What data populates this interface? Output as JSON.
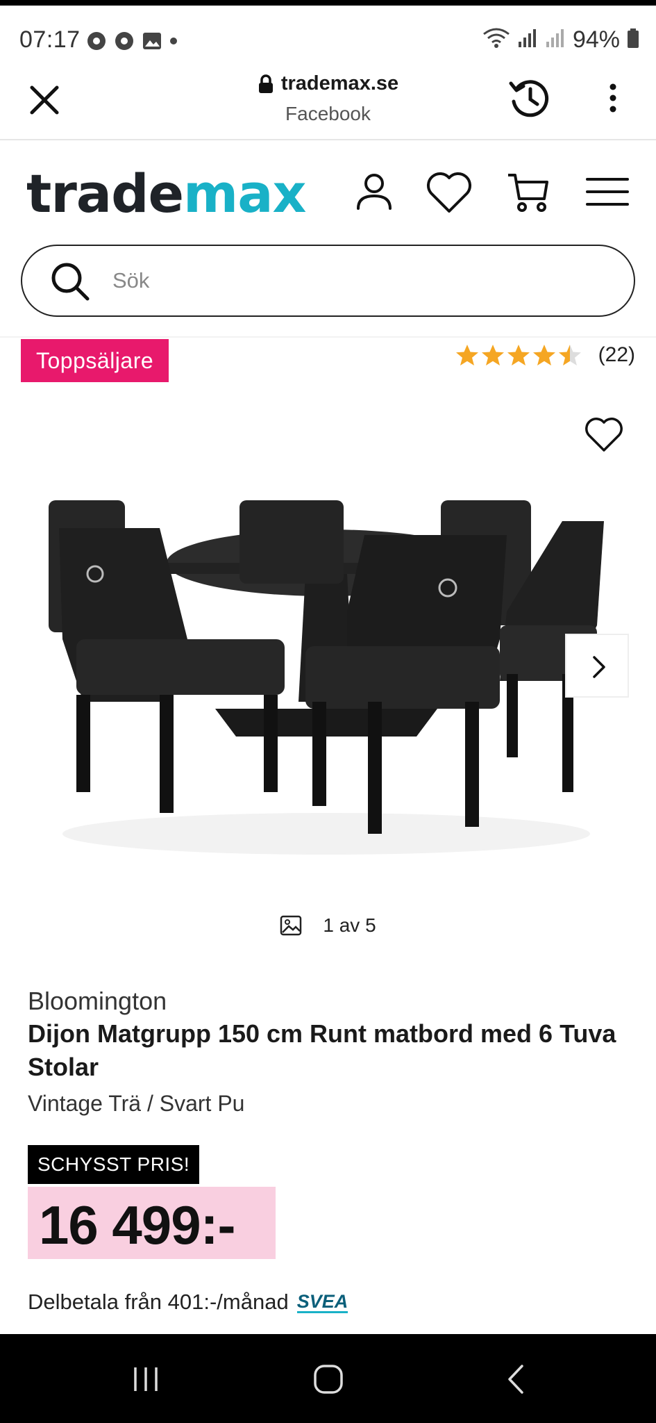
{
  "status_bar": {
    "time": "07:17",
    "battery": "94%"
  },
  "browser": {
    "domain": "trademax.se",
    "subtitle": "Facebook"
  },
  "site": {
    "logo_part1": "trade",
    "logo_part2": "max",
    "brand_color": "#19b1c7",
    "search_placeholder": "Sök"
  },
  "product": {
    "badge": "Toppsäljare",
    "badge_color": "#e8196c",
    "rating": 4.5,
    "review_count": "(22)",
    "image_counter": "1 av 5",
    "brand": "Bloomington",
    "title": "Dijon Matgrupp 150 cm Runt matbord med 6 Tuva Stolar",
    "variant": "Vintage Trä / Svart Pu",
    "price_tag": "SCHYSST PRIS!",
    "price": "16 499:-",
    "installment": "Delbetala från 401:-/månad",
    "payment_provider": "SVEA"
  }
}
